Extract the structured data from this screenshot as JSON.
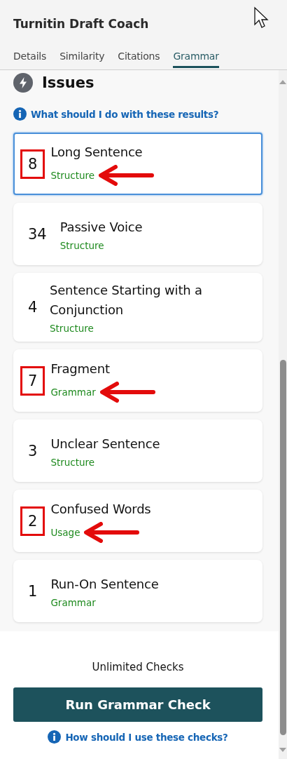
{
  "header": {
    "title": "Turnitin Draft Coach"
  },
  "tabs": [
    {
      "label": "Details",
      "selected": false
    },
    {
      "label": "Similarity",
      "selected": false
    },
    {
      "label": "Citations",
      "selected": false
    },
    {
      "label": "Grammar",
      "selected": true
    }
  ],
  "section": {
    "title": "Issues",
    "help_link": "What should I do with these results?"
  },
  "issues": [
    {
      "count": "8",
      "title": "Long Sentence",
      "category": "Structure",
      "selected": true,
      "annotated": true
    },
    {
      "count": "34",
      "title": "Passive Voice",
      "category": "Structure",
      "selected": false,
      "annotated": false
    },
    {
      "count": "4",
      "title": "Sentence Starting with a Conjunction",
      "category": "Structure",
      "selected": false,
      "annotated": false
    },
    {
      "count": "7",
      "title": "Fragment",
      "category": "Grammar",
      "selected": false,
      "annotated": true
    },
    {
      "count": "3",
      "title": "Unclear Sentence",
      "category": "Structure",
      "selected": false,
      "annotated": false
    },
    {
      "count": "2",
      "title": "Confused Words",
      "category": "Usage",
      "selected": false,
      "annotated": true
    },
    {
      "count": "1",
      "title": "Run-On Sentence",
      "category": "Grammar",
      "selected": false,
      "annotated": false
    }
  ],
  "footer": {
    "checks_label": "Unlimited Checks",
    "button": "Run Grammar Check",
    "help_link": "How should I use these checks?"
  }
}
